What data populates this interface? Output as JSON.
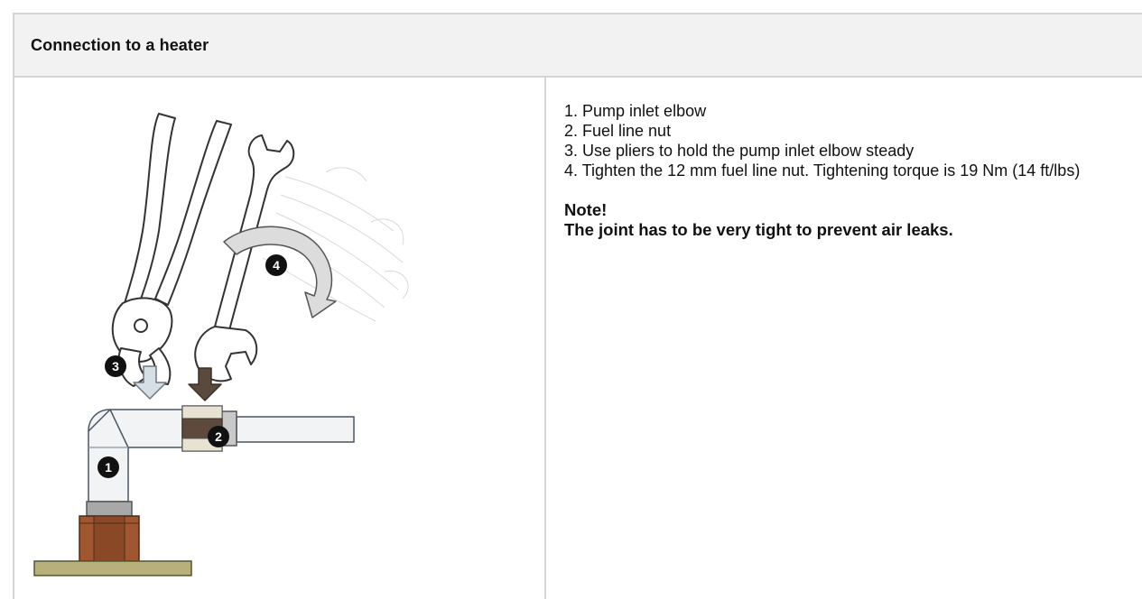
{
  "header": {
    "title": "Connection to a heater"
  },
  "illustration": {
    "callouts": [
      "1",
      "2",
      "3",
      "4"
    ],
    "colors": {
      "pipe_fill": "#f1f3f5",
      "pipe_stroke": "#4a5560",
      "nut_dark": "#5e4a3c",
      "nut_light": "#e8e2d2",
      "fitting_brown": "#a0562f",
      "base_plate": "#b8b07a",
      "arrow_light": "#d6dee6",
      "arrow_brown": "#5a4a3e",
      "callout_fill": "#111111"
    }
  },
  "instructions": {
    "steps": [
      "1. Pump inlet elbow",
      "2. Fuel line nut",
      "3. Use pliers to hold the pump inlet elbow steady",
      "4. Tighten the 12 mm fuel line nut. Tightening torque is 19 Nm (14 ft/lbs)"
    ],
    "note_title": "Note!",
    "note_text": "The joint has to be very tight to prevent air leaks."
  }
}
